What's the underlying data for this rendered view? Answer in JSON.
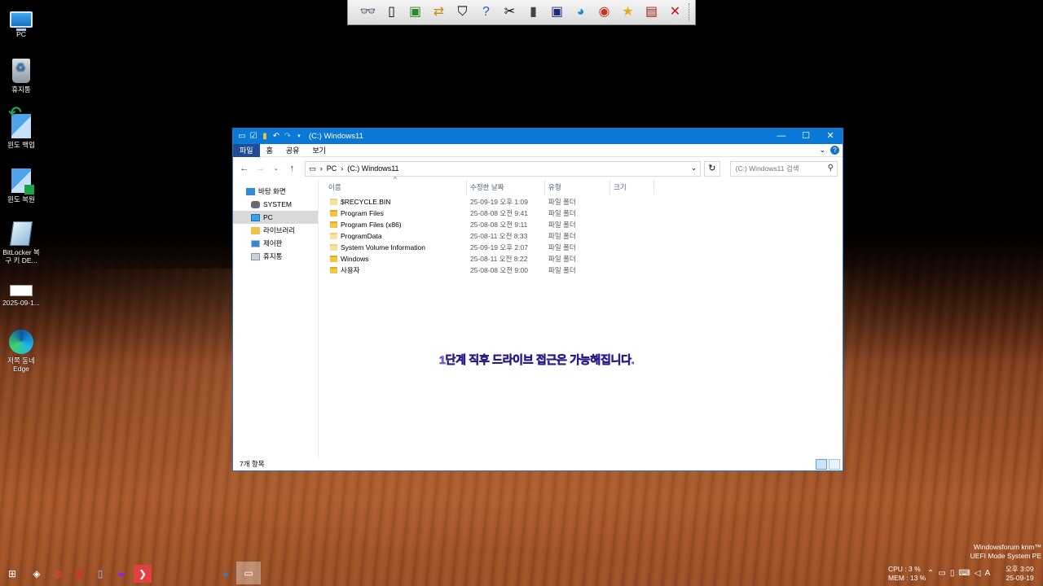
{
  "desktop": {
    "icons": [
      {
        "label": "PC",
        "icon": "pc-icon"
      },
      {
        "label": "휴지통",
        "icon": "recycle-bin-icon"
      },
      {
        "label": "윈도 백업",
        "icon": "backup-icon"
      },
      {
        "label": "윈도 복원",
        "icon": "restore-icon"
      },
      {
        "label": "BitLocker 복구 키 DE...",
        "icon": "bitlocker-icon"
      },
      {
        "label": "2025-09-1...",
        "icon": "file-icon"
      },
      {
        "label": "저쪽 동네 Edge",
        "icon": "edge-icon"
      }
    ]
  },
  "top_toolbar": {
    "icons": [
      "glasses-icon",
      "phone-icon",
      "monitor-tool-icon",
      "transfer-icon",
      "shield-icon",
      "help-icon",
      "tools-icon",
      "book-icon",
      "display-icon",
      "edge-icon",
      "chrome-icon",
      "folder-star-icon",
      "window-icon",
      "close-icon"
    ]
  },
  "explorer": {
    "title": "(C:) Windows11",
    "ribbon_tabs": [
      "파일",
      "홈",
      "공유",
      "보기"
    ],
    "address": {
      "crumbs": [
        "PC",
        "(C:) Windows11"
      ]
    },
    "search_placeholder": "(C:) Windows11 검색",
    "nav_items": [
      {
        "label": "바탕 화면",
        "icon": "desktop-icon",
        "indent": false,
        "selected": false
      },
      {
        "label": "SYSTEM",
        "icon": "user-icon",
        "indent": true,
        "selected": false
      },
      {
        "label": "PC",
        "icon": "pc-icon",
        "indent": true,
        "selected": true
      },
      {
        "label": "라이브러리",
        "icon": "library-icon",
        "indent": true,
        "selected": false
      },
      {
        "label": "제어판",
        "icon": "control-panel-icon",
        "indent": true,
        "selected": false
      },
      {
        "label": "휴지통",
        "icon": "recycle-bin-icon",
        "indent": true,
        "selected": false
      }
    ],
    "columns": [
      "이름",
      "수정한 날짜",
      "유형",
      "크기"
    ],
    "files": [
      {
        "name": "$RECYCLE.BIN",
        "date": "25-09-19 오후 1:09",
        "type": "파일 폴더",
        "hidden": true
      },
      {
        "name": "Program Files",
        "date": "25-08-08 오전 9:41",
        "type": "파일 폴더",
        "hidden": false
      },
      {
        "name": "Program Files (x86)",
        "date": "25-08-08 오전 9:11",
        "type": "파일 폴더",
        "hidden": false
      },
      {
        "name": "ProgramData",
        "date": "25-08-11 오전 8:33",
        "type": "파일 폴더",
        "hidden": true
      },
      {
        "name": "System Volume Information",
        "date": "25-09-19 오후 2:07",
        "type": "파일 폴더",
        "hidden": true
      },
      {
        "name": "Windows",
        "date": "25-08-11 오전 8:22",
        "type": "파일 폴더",
        "hidden": false
      },
      {
        "name": "사용자",
        "date": "25-08-08 오전 9:00",
        "type": "파일 폴더",
        "hidden": false
      }
    ],
    "overlay_text": "1단계 직후 드라이브 접근은 가능해집니다.",
    "status": "7개 항목"
  },
  "tray": {
    "cpu": "CPU :   3 %",
    "mem": "MEM : 13 %",
    "sysinfo_line1": "Windowsforum knm™",
    "sysinfo_line2": "UEFI Mode System PE",
    "time": "오후 3:09",
    "date": "25-09-19",
    "ime": "A"
  }
}
